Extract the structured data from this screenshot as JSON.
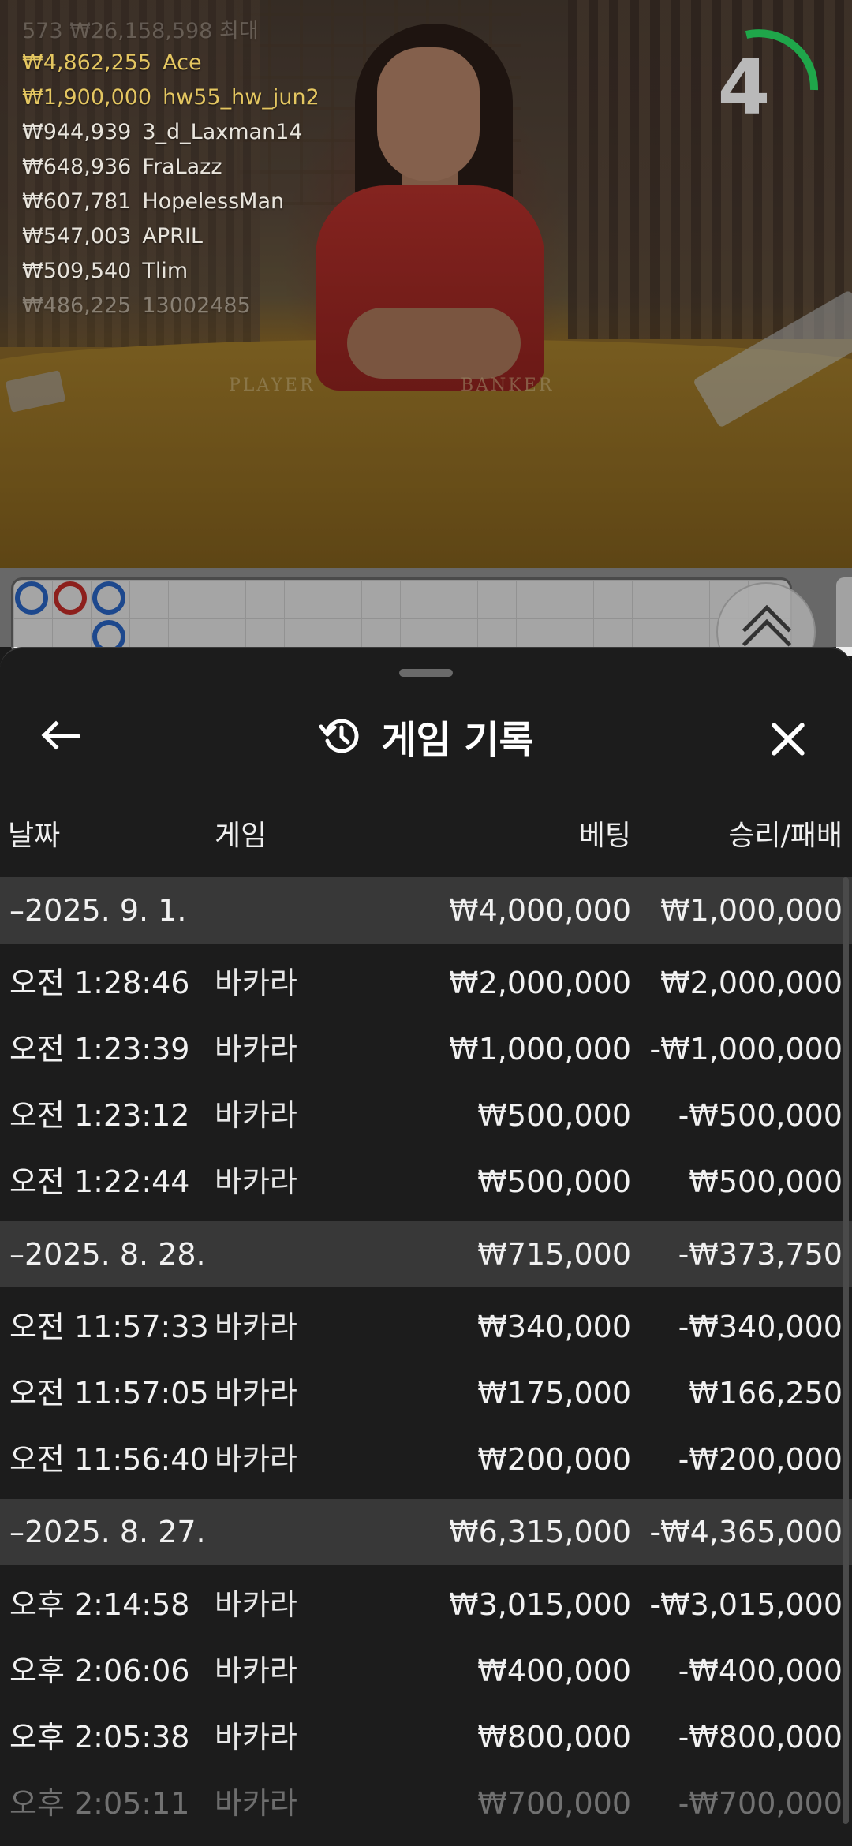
{
  "live": {
    "winners_top_partial": "573  ₩26,158,598 최대",
    "winners": [
      {
        "amount": "₩4,862,255",
        "name": "Ace"
      },
      {
        "amount": "₩1,900,000",
        "name": "hw55_hw_jun2"
      },
      {
        "amount": "₩944,939",
        "name": "3_d_Laxman14"
      },
      {
        "amount": "₩648,936",
        "name": "FraLazz"
      },
      {
        "amount": "₩607,781",
        "name": "HopelessMan"
      },
      {
        "amount": "₩547,003",
        "name": "APRIL"
      },
      {
        "amount": "₩509,540",
        "name": "Tlim"
      },
      {
        "amount": "₩486,225",
        "name": "13002485"
      }
    ],
    "table_labels": {
      "player": "PLAYER",
      "banker": "BANKER"
    },
    "countdown": "4",
    "countdown_color": "#1fa64a"
  },
  "history": {
    "title": "게임 기록",
    "columns": {
      "date": "날짜",
      "game": "게임",
      "bet": "베팅",
      "win_loss": "승리/패배"
    },
    "groups": [
      {
        "date": "–2025. 9. 1.",
        "bet": "₩4,000,000",
        "win_loss": "₩1,000,000",
        "rows": [
          {
            "time": "오전 1:28:46",
            "game": "바카라",
            "bet": "₩2,000,000",
            "win_loss": "₩2,000,000"
          },
          {
            "time": "오전 1:23:39",
            "game": "바카라",
            "bet": "₩1,000,000",
            "win_loss": "-₩1,000,000"
          },
          {
            "time": "오전 1:23:12",
            "game": "바카라",
            "bet": "₩500,000",
            "win_loss": "-₩500,000"
          },
          {
            "time": "오전 1:22:44",
            "game": "바카라",
            "bet": "₩500,000",
            "win_loss": "₩500,000"
          }
        ]
      },
      {
        "date": "–2025. 8. 28.",
        "bet": "₩715,000",
        "win_loss": "-₩373,750",
        "rows": [
          {
            "time": "오전 11:57:33",
            "game": "바카라",
            "bet": "₩340,000",
            "win_loss": "-₩340,000"
          },
          {
            "time": "오전 11:57:05",
            "game": "바카라",
            "bet": "₩175,000",
            "win_loss": "₩166,250"
          },
          {
            "time": "오전 11:56:40",
            "game": "바카라",
            "bet": "₩200,000",
            "win_loss": "-₩200,000"
          }
        ]
      },
      {
        "date": "–2025. 8. 27.",
        "bet": "₩6,315,000",
        "win_loss": "-₩4,365,000",
        "rows": [
          {
            "time": "오후 2:14:58",
            "game": "바카라",
            "bet": "₩3,015,000",
            "win_loss": "-₩3,015,000"
          },
          {
            "time": "오후 2:06:06",
            "game": "바카라",
            "bet": "₩400,000",
            "win_loss": "-₩400,000"
          },
          {
            "time": "오후 2:05:38",
            "game": "바카라",
            "bet": "₩800,000",
            "win_loss": "-₩800,000"
          },
          {
            "time": "오후 2:05:11",
            "game": "바카라",
            "bet": "₩700,000",
            "win_loss": "-₩700,000"
          }
        ]
      }
    ]
  },
  "icons": {
    "back": "arrow-left-icon",
    "history": "history-clock-icon",
    "close": "close-icon",
    "expand": "chevron-up-double-icon"
  }
}
